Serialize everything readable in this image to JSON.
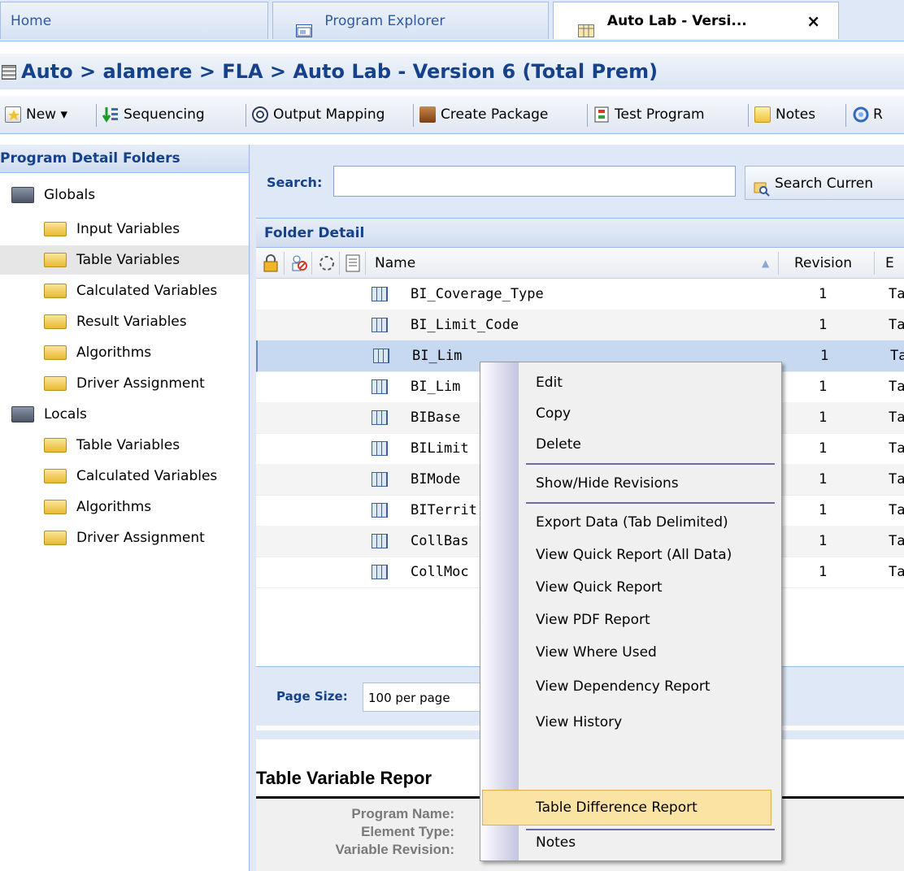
{
  "tabs": {
    "home": "Home",
    "explorer": "Program Explorer",
    "auto_lab": "Auto Lab - Versi...",
    "close": "×"
  },
  "breadcrumb": "Auto > alamere > FLA > Auto Lab - Version 6 (Total Prem)",
  "toolbar": {
    "new": "New",
    "sequencing": "Sequencing",
    "output_mapping": "Output Mapping",
    "create_package": "Create Package",
    "test_program": "Test Program",
    "notes": "Notes",
    "r": "R"
  },
  "left_panel": {
    "title": "Program Detail Folders",
    "globals": "Globals",
    "globals_items": [
      "Input Variables",
      "Table Variables",
      "Calculated Variables",
      "Result Variables",
      "Algorithms",
      "Driver Assignment"
    ],
    "locals": "Locals",
    "locals_items": [
      "Table Variables",
      "Calculated Variables",
      "Algorithms",
      "Driver Assignment"
    ]
  },
  "search": {
    "label": "Search:",
    "value": "",
    "button": "Search Curren"
  },
  "grid": {
    "title": "Folder Detail",
    "col_name": "Name",
    "col_revision": "Revision",
    "col_e": "E",
    "rows": [
      {
        "name": "BI_Coverage_Type",
        "revision": "1",
        "type": "Ta"
      },
      {
        "name": "BI_Limit_Code",
        "revision": "1",
        "type": "Ta"
      },
      {
        "name": "BI_Lim",
        "revision": "1",
        "type": "Ta"
      },
      {
        "name": "BI_Lim",
        "revision": "1",
        "type": "Ta"
      },
      {
        "name": "BIBase",
        "revision": "1",
        "type": "Ta"
      },
      {
        "name": "BILimit",
        "revision": "1",
        "type": "Ta"
      },
      {
        "name": "BIMode",
        "revision": "1",
        "type": "Ta"
      },
      {
        "name": "BITerrit",
        "revision": "1",
        "type": "Ta"
      },
      {
        "name": "CollBas",
        "revision": "1",
        "type": "Ta"
      },
      {
        "name": "CollMoc",
        "revision": "1",
        "type": "Ta"
      }
    ]
  },
  "page_size": {
    "label": "Page Size:",
    "value": "100 per page"
  },
  "report": {
    "title": "Table Variable Repor",
    "program_name": "Program Name:",
    "element_type": "Element Type:",
    "variable_revision": "Variable Revision:"
  },
  "context_menu": {
    "items": [
      "Edit",
      "Copy",
      "Delete",
      "Show/Hide Revisions",
      "Export Data (Tab Delimited)",
      "View Quick Report (All Data)",
      "View Quick Report",
      "View PDF Report",
      "View Where Used",
      "View Dependency Report",
      "View History",
      "Table Difference Report",
      "Notes"
    ],
    "highlighted": "Table Difference Report"
  },
  "colors": {
    "header_blue": "#15428b",
    "panel_bg": "#dfe8f6",
    "selected_row": "#c7d9f1",
    "menu_highlight": "#fbe3a3"
  }
}
